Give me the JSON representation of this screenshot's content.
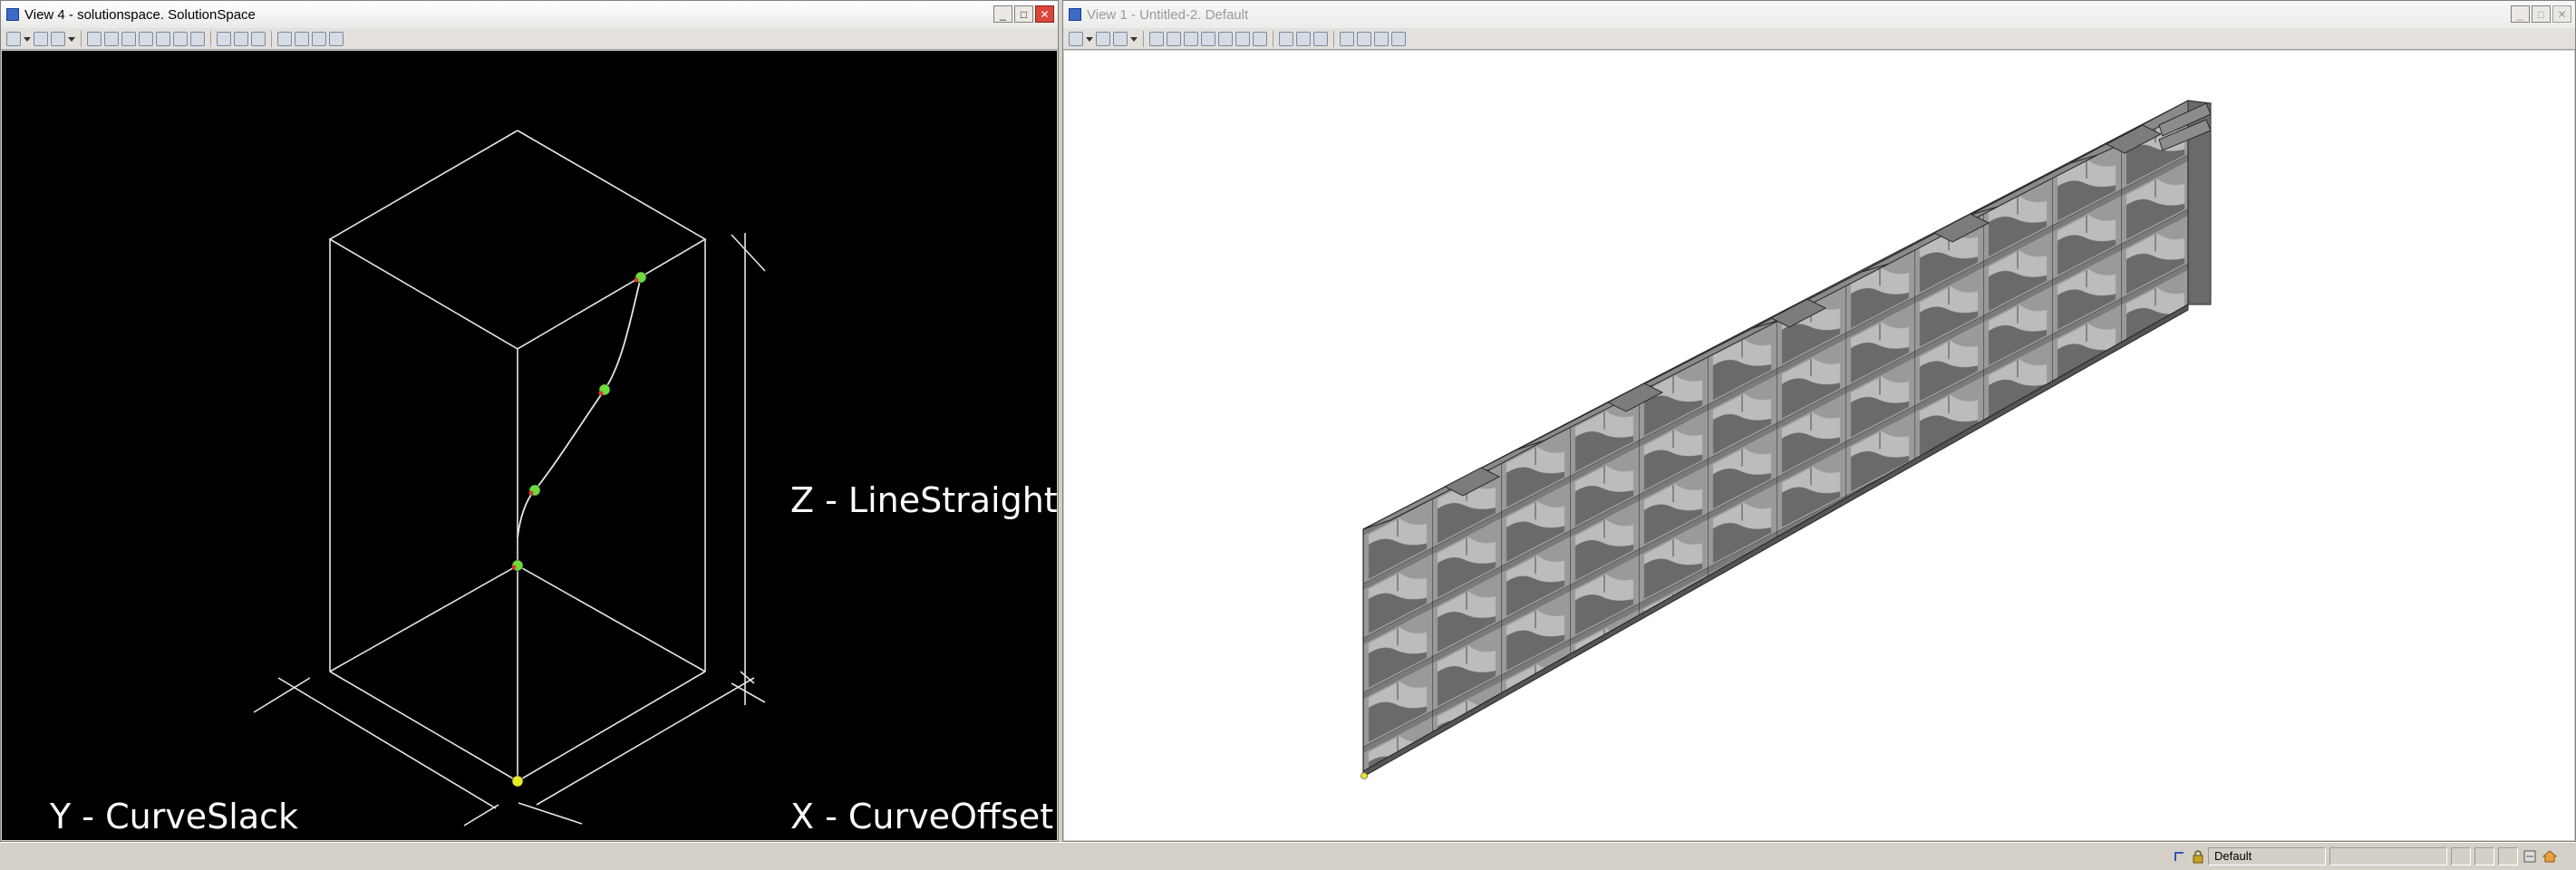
{
  "left_window": {
    "title": "View 4 - solutionspace. SolutionSpace",
    "axis_labels": {
      "z": "Z - LineStraight",
      "y": "Y - CurveSlack",
      "x": "X - CurveOffset"
    }
  },
  "right_window": {
    "title": "View 1 - Untitled-2. Default"
  },
  "window_buttons": {
    "minimize": "_",
    "maximize": "□",
    "close": "✕"
  },
  "statusbar": {
    "level": "Default",
    "icons": [
      "snap-icon",
      "lock-icon",
      "settings-icon",
      "home-icon"
    ]
  },
  "colors": {
    "left_viewport_bg": "#000000",
    "right_viewport_bg": "#ffffff",
    "wireframe": "#e6e6e6",
    "point_green": "#6ddc3c",
    "point_red": "#d93a2b",
    "origin_point": "#e8e82a",
    "wall_face": "#9a9a9a",
    "wall_top": "#7c7c7c",
    "wall_dark": "#5a5a5a"
  }
}
